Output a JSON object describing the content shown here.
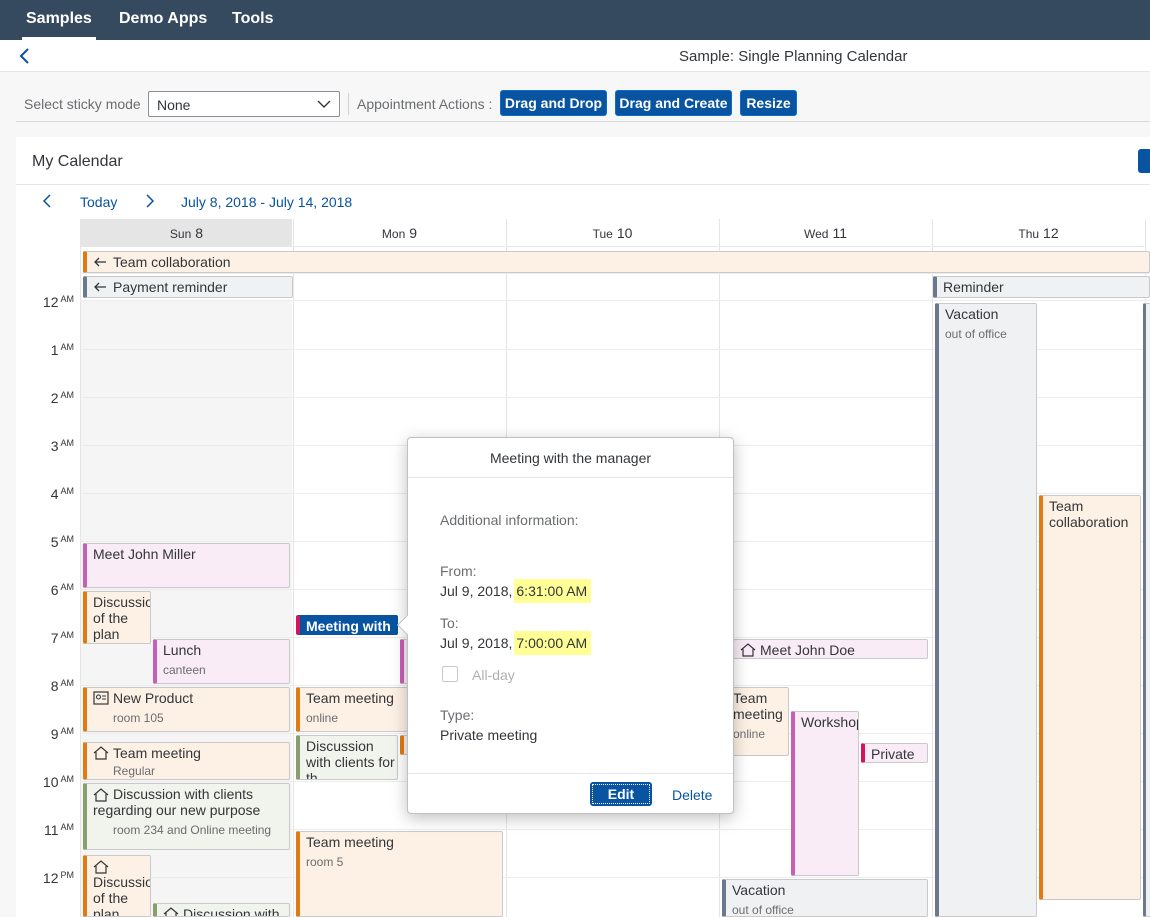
{
  "topnav": {
    "tabs": [
      "Samples",
      "Demo Apps",
      "Tools"
    ]
  },
  "page": {
    "title": "Sample: Single Planning Calendar"
  },
  "toolbar": {
    "sticky_label": "Select sticky mode",
    "sticky_value": "None",
    "actions_label": "Appointment Actions :",
    "buttons": [
      "Drag and Drop",
      "Drag and Create",
      "Resize"
    ]
  },
  "calendar": {
    "title": "My Calendar",
    "today": "Today",
    "range": "July 8, 2018 - July 14, 2018",
    "days": [
      {
        "name": "Sun",
        "num": "8"
      },
      {
        "name": "Mon",
        "num": "9"
      },
      {
        "name": "Tue",
        "num": "10"
      },
      {
        "name": "Wed",
        "num": "11"
      },
      {
        "name": "Thu",
        "num": "12"
      }
    ],
    "hours": [
      {
        "h": "12",
        "p": "AM"
      },
      {
        "h": "1",
        "p": "AM"
      },
      {
        "h": "2",
        "p": "AM"
      },
      {
        "h": "3",
        "p": "AM"
      },
      {
        "h": "4",
        "p": "AM"
      },
      {
        "h": "5",
        "p": "AM"
      },
      {
        "h": "6",
        "p": "AM"
      },
      {
        "h": "7",
        "p": "AM"
      },
      {
        "h": "8",
        "p": "AM"
      },
      {
        "h": "9",
        "p": "AM"
      },
      {
        "h": "10",
        "p": "AM"
      },
      {
        "h": "11",
        "p": "AM"
      },
      {
        "h": "12",
        "p": "PM"
      }
    ],
    "allday": {
      "team_collab": "Team collaboration",
      "payment": "Payment reminder",
      "reminder": "Reminder"
    },
    "appts": {
      "vacation_thu": {
        "title": "Vacation",
        "sub": "out of office"
      },
      "team_collab_thu": {
        "title": "Team collaboration"
      },
      "meet_john_miller": {
        "title": "Meet John Miller"
      },
      "discussion_plan": {
        "title": "Discussion of the plan"
      },
      "lunch": {
        "title": "Lunch",
        "sub": "canteen"
      },
      "new_product": {
        "title": "New Product",
        "sub": "room 105"
      },
      "team_meeting_regular": {
        "title": "Team meeting",
        "sub": "Regular"
      },
      "discussion_clients_sun": {
        "title": "Discussion with clients regarding our new purpose",
        "sub": "room 234 and Online meeting"
      },
      "discussion_sun_small": {
        "title": "Discussion of the plan"
      },
      "discussion_with_bottom": {
        "title": "Discussion with"
      },
      "meeting_with_mon": {
        "title": "Meeting with t"
      },
      "team_meeting_online_mon": {
        "title": "Team meeting",
        "sub": "online"
      },
      "discussion_clients_mon": {
        "title": "Discussion with clients for th"
      },
      "team_meeting_room5": {
        "title": "Team meeting",
        "sub": "room 5"
      },
      "meet_john_doe": {
        "title": "Meet John Doe"
      },
      "team_meeting_wed": {
        "title": "Team meeting",
        "sub": "online"
      },
      "workshop": {
        "title": "Workshop"
      },
      "private": {
        "title": "Private"
      },
      "vacation_wed": {
        "title": "Vacation",
        "sub": "out of office"
      }
    }
  },
  "popover": {
    "title": "Meeting with the manager",
    "additional": "Additional information:",
    "from_label": "From:",
    "from_date": "Jul 9, 2018,",
    "from_time": "6:31:00 AM",
    "to_label": "To:",
    "to_date": "Jul 9, 2018,",
    "to_time": "7:00:00 AM",
    "allday": "All-day",
    "type_label": "Type:",
    "type_value": "Private meeting",
    "edit": "Edit",
    "delete": "Delete"
  },
  "colors": {
    "shell": "#354a5f",
    "accent": "#0854a0",
    "highlight": "#ffff96"
  }
}
